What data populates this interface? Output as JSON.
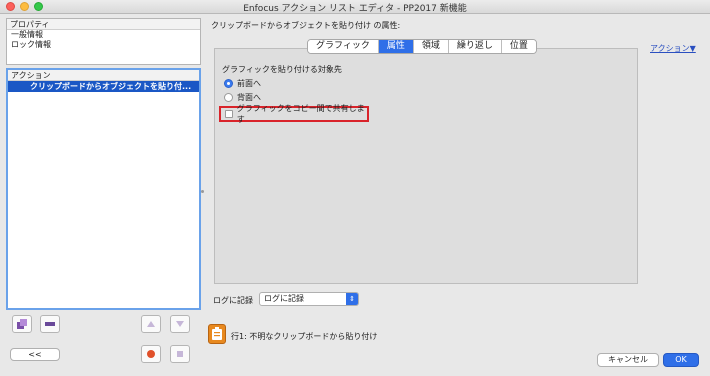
{
  "window": {
    "title": "Enfocus アクション リスト エディタ - PP2017 新機能"
  },
  "properties_panel": {
    "header": "プロパティ",
    "items": [
      "一般情報",
      "ロック情報"
    ]
  },
  "actions_panel": {
    "header": "アクション",
    "selected_item": "クリップボードからオブジェクトを貼り付..."
  },
  "left_buttons": {
    "back": "<<"
  },
  "main": {
    "header": "クリップボードからオブジェクトを貼り付け の属性:",
    "action_menu": "アクション▼",
    "tabs": [
      "グラフィック",
      "属性",
      "領域",
      "繰り返し",
      "位置"
    ],
    "active_tab": "属性",
    "group_label": "グラフィックを貼り付ける対象先",
    "radio_front": "前面へ",
    "radio_back": "背面へ",
    "checkbox_share": "グラフィックをコピー間で共有します"
  },
  "log": {
    "label": "ログに記録",
    "selected": "ログに記録"
  },
  "status": {
    "message": "行1: 不明なクリップボードから貼り付け"
  },
  "buttons": {
    "cancel": "キャンセル",
    "ok": "OK"
  },
  "colors": {
    "accent": "#2f6fe8",
    "selection": "#1a57c5",
    "highlight_box": "#d9232a"
  }
}
